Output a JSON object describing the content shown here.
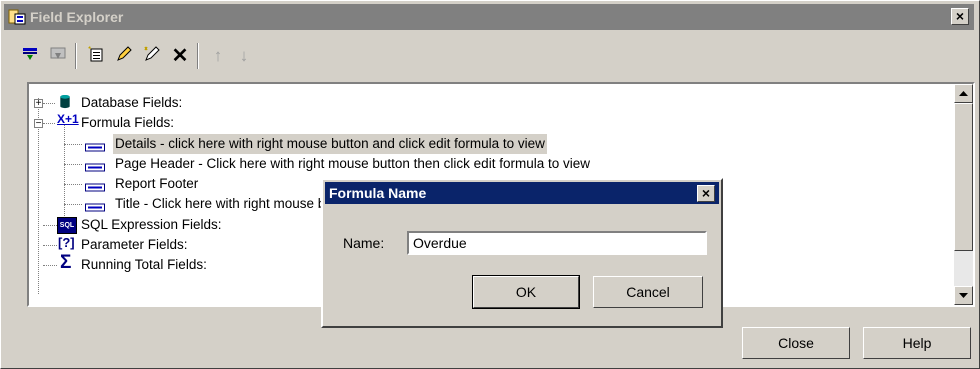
{
  "window": {
    "title": "Field Explorer"
  },
  "toolbar": {
    "icons": [
      "insert-field-icon",
      "browse-field-icon",
      "new-formula-icon",
      "edit-icon",
      "rename-icon",
      "delete-icon",
      "move-up-icon",
      "move-down-icon"
    ]
  },
  "tree": {
    "items": [
      {
        "label": "Database Fields:",
        "expander": "+"
      },
      {
        "label": "Formula Fields:",
        "expander": "−",
        "prefix": "X+1"
      },
      {
        "label": "Details - click here with right mouse button and click edit formula to view",
        "selected": true
      },
      {
        "label": "Page Header - Click here with right mouse button then click edit formula to view"
      },
      {
        "label": "Report Footer"
      },
      {
        "label": "Title - Click here with right mouse button and click edit formula to view"
      },
      {
        "label": "SQL Expression Fields:",
        "prefix": "SQL"
      },
      {
        "label": "Parameter Fields:",
        "prefix": "[?]"
      },
      {
        "label": "Running Total Fields:",
        "prefix": "Σ"
      }
    ]
  },
  "buttons": {
    "close": "Close",
    "help": "Help"
  },
  "dialog": {
    "title": "Formula Name",
    "name_label": "Name:",
    "name_value": "Overdue",
    "ok": "OK",
    "cancel": "Cancel"
  },
  "colors": {
    "titlebar_inactive": "#808080",
    "titlebar_active": "#0a246a",
    "face": "#d4d0c8"
  }
}
